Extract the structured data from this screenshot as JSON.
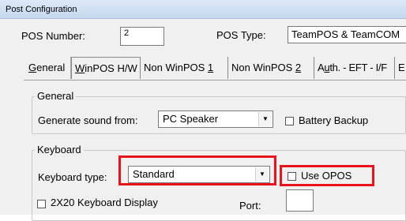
{
  "window": {
    "title": "Post Configuration"
  },
  "pos": {
    "number_label": "POS Number:",
    "number_value": "2",
    "type_label": "POS Type:",
    "type_value": "TeamPOS & TeamCOM"
  },
  "tabs": [
    {
      "pre": "",
      "ul": "G",
      "post": "eneral"
    },
    {
      "pre": "",
      "ul": "W",
      "post": "inPOS H/W"
    },
    {
      "pre": "Non WinPOS ",
      "ul": "1",
      "post": ""
    },
    {
      "pre": "Non WinPOS ",
      "ul": "2",
      "post": ""
    },
    {
      "pre": "A",
      "ul": "u",
      "post": "th. - EFT - I/F"
    },
    {
      "pre": "E",
      "ul": "",
      "post": ""
    }
  ],
  "general_group": {
    "title": "General",
    "sound_label": "Generate sound from:",
    "sound_value": "PC Speaker",
    "battery_label": "Battery Backup"
  },
  "keyboard_group": {
    "title": "Keyboard",
    "type_label": "Keyboard type:",
    "type_value": "Standard",
    "use_opos_label": "Use OPOS",
    "display_label": "2X20 Keyboard Display",
    "port_label": "Port:"
  },
  "icons": {
    "dropdown": "chevron-down-icon"
  },
  "colors": {
    "highlight": "#e8141c",
    "titlebar": "#c6d9f0"
  }
}
